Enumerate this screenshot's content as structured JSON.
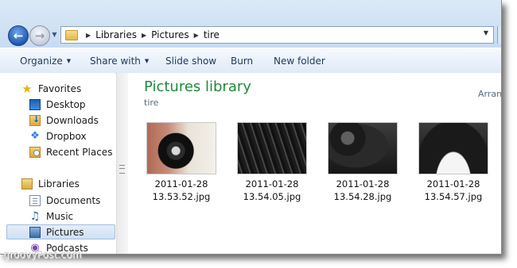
{
  "address": {
    "breadcrumbs": [
      "Libraries",
      "Pictures",
      "tire"
    ]
  },
  "toolbar": {
    "organize": "Organize",
    "share_with": "Share with",
    "slide_show": "Slide show",
    "burn": "Burn",
    "new_folder": "New folder"
  },
  "sidebar": {
    "favorites_header": "Favorites",
    "favorites": [
      {
        "label": "Desktop",
        "icon": "desktop-icon"
      },
      {
        "label": "Downloads",
        "icon": "downloads-folder-icon"
      },
      {
        "label": "Dropbox",
        "icon": "dropbox-icon"
      },
      {
        "label": "Recent Places",
        "icon": "recent-places-icon"
      }
    ],
    "libraries_header": "Libraries",
    "libraries": [
      {
        "label": "Documents",
        "icon": "documents-icon"
      },
      {
        "label": "Music",
        "icon": "music-icon"
      },
      {
        "label": "Pictures",
        "icon": "pictures-icon",
        "selected": true
      },
      {
        "label": "Podcasts",
        "icon": "podcasts-icon"
      }
    ]
  },
  "content": {
    "title": "Pictures library",
    "subtitle": "tire",
    "arrange_label": "Arran",
    "files": [
      {
        "line1": "2011-01-28",
        "line2": "13.53.52.jpg"
      },
      {
        "line1": "2011-01-28",
        "line2": "13.54.05.jpg"
      },
      {
        "line1": "2011-01-28",
        "line2": "13.54.28.jpg"
      },
      {
        "line1": "2011-01-28",
        "line2": "13.54.57.jpg"
      }
    ]
  },
  "watermark": "groovyPost.com",
  "colors": {
    "library_title": "#1e8a3a",
    "toolbar_text": "#1e395b",
    "selection": "#cfe0f3"
  }
}
